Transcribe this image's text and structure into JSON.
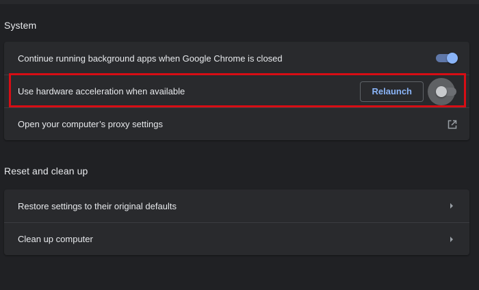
{
  "system": {
    "title": "System",
    "rows": [
      {
        "label": "Continue running background apps when Google Chrome is closed",
        "toggle": "on"
      },
      {
        "label": "Use hardware acceleration when available",
        "button": "Relaunch",
        "toggle": "off"
      },
      {
        "label": "Open your computer’s proxy settings",
        "icon": "open-in-new-icon"
      }
    ]
  },
  "reset": {
    "title": "Reset and clean up",
    "rows": [
      {
        "label": "Restore settings to their original defaults",
        "icon": "arrow-right-icon"
      },
      {
        "label": "Clean up computer",
        "icon": "arrow-right-icon"
      }
    ]
  },
  "colors": {
    "background": "#202124",
    "card": "#292a2d",
    "accent": "#8ab4f8",
    "highlight": "#d80d14"
  }
}
